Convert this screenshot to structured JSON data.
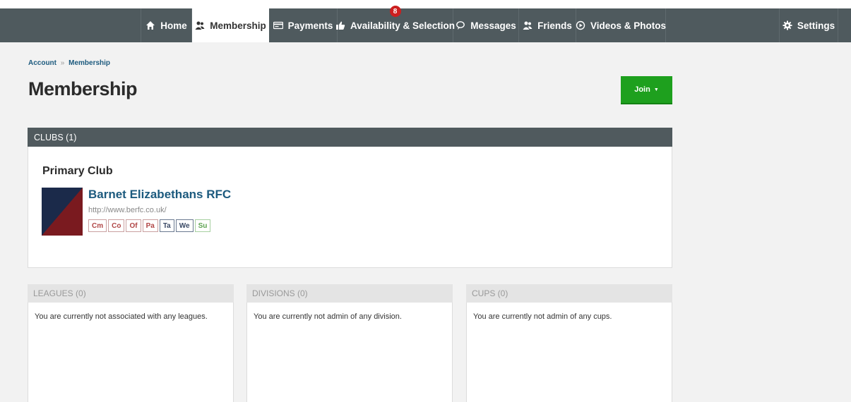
{
  "nav": {
    "items": [
      {
        "label": "Home",
        "icon": "home-icon"
      },
      {
        "label": "Membership",
        "icon": "users-icon"
      },
      {
        "label": "Payments",
        "icon": "card-icon"
      },
      {
        "label": "Availability & Selection",
        "icon": "thumbs-up-icon",
        "badge": "8"
      },
      {
        "label": "Messages",
        "icon": "chat-bubble-icon"
      },
      {
        "label": "Friends",
        "icon": "users-icon"
      },
      {
        "label": "Videos & Photos",
        "icon": "play-circle-icon"
      }
    ],
    "settings": {
      "label": "Settings",
      "icon": "gear-icon"
    }
  },
  "breadcrumb": {
    "account": "Account",
    "separator": "»",
    "current": "Membership"
  },
  "page": {
    "title": "Membership",
    "join_label": "Join",
    "join_caret": "▼"
  },
  "clubs": {
    "header": "CLUBS (1)",
    "primary_label": "Primary Club",
    "club": {
      "name": "Barnet Elizabethans RFC",
      "url": "http://www.berfc.co.uk/",
      "roles": [
        {
          "code": "Cm",
          "tone": "red"
        },
        {
          "code": "Co",
          "tone": "red"
        },
        {
          "code": "Of",
          "tone": "red"
        },
        {
          "code": "Pa",
          "tone": "red"
        },
        {
          "code": "Ta",
          "tone": "blue"
        },
        {
          "code": "We",
          "tone": "blue"
        },
        {
          "code": "Su",
          "tone": "green"
        }
      ]
    }
  },
  "leagues": {
    "header": "LEAGUES (0)",
    "text": "You are currently not associated with any leagues."
  },
  "divisions": {
    "header": "DIVISIONS (0)",
    "text": "You are currently not admin of any division."
  },
  "cups": {
    "header": "CUPS (0)",
    "text": "You are currently not admin of any cups."
  },
  "colors": {
    "nav_bg": "#4f5a5e",
    "link": "#1c5a7e",
    "join_green": "#1ea01e",
    "badge_red": "#cc1f1f",
    "logo_navy": "#1b2a4a",
    "logo_red": "#7a1a1f"
  }
}
